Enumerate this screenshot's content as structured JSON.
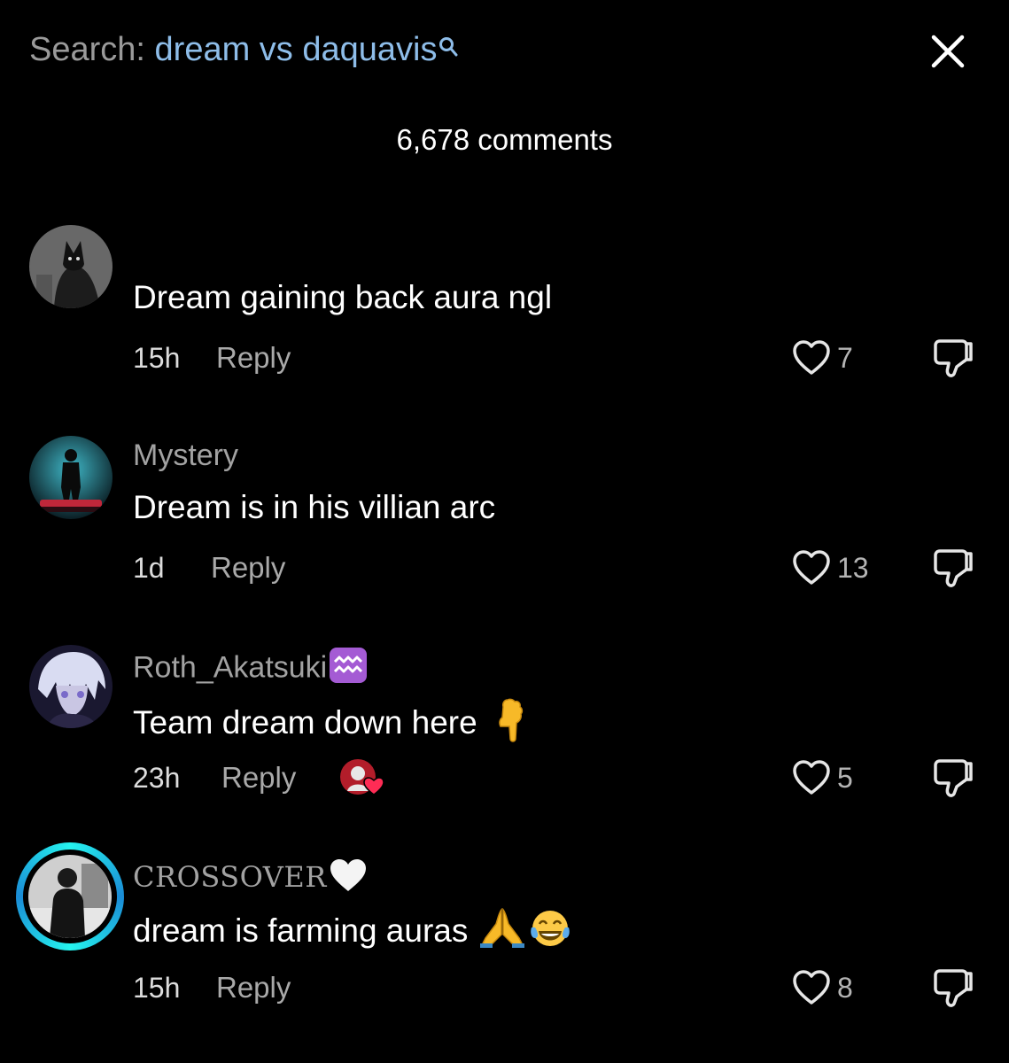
{
  "search": {
    "label": "Search:",
    "query": "dream vs daquavis"
  },
  "comments_count": "6,678 comments",
  "comments": [
    {
      "username": "",
      "text": "Dream gaining back aura ngl",
      "time": "15h",
      "reply_label": "Reply",
      "likes": "7"
    },
    {
      "username": "Mystery",
      "text": "Dream is in his villian arc",
      "time": "1d",
      "reply_label": "Reply",
      "likes": "13"
    },
    {
      "username": "Roth_Akatsuki",
      "text": "Team dream down here",
      "time": "23h",
      "reply_label": "Reply",
      "likes": "5",
      "creator_liked": true
    },
    {
      "username": "CROSSOVER",
      "text": "dream is farming auras",
      "time": "15h",
      "reply_label": "Reply",
      "likes": "8",
      "story_ring": true
    }
  ],
  "icons": {
    "close": "close-icon",
    "search": "search-icon",
    "like": "heart-outline-icon",
    "dislike": "thumbs-down-icon"
  },
  "colors": {
    "background": "#000000",
    "query": "#8ebde9",
    "ring": "#25f4ee",
    "liked_heart": "#fe2c55"
  }
}
